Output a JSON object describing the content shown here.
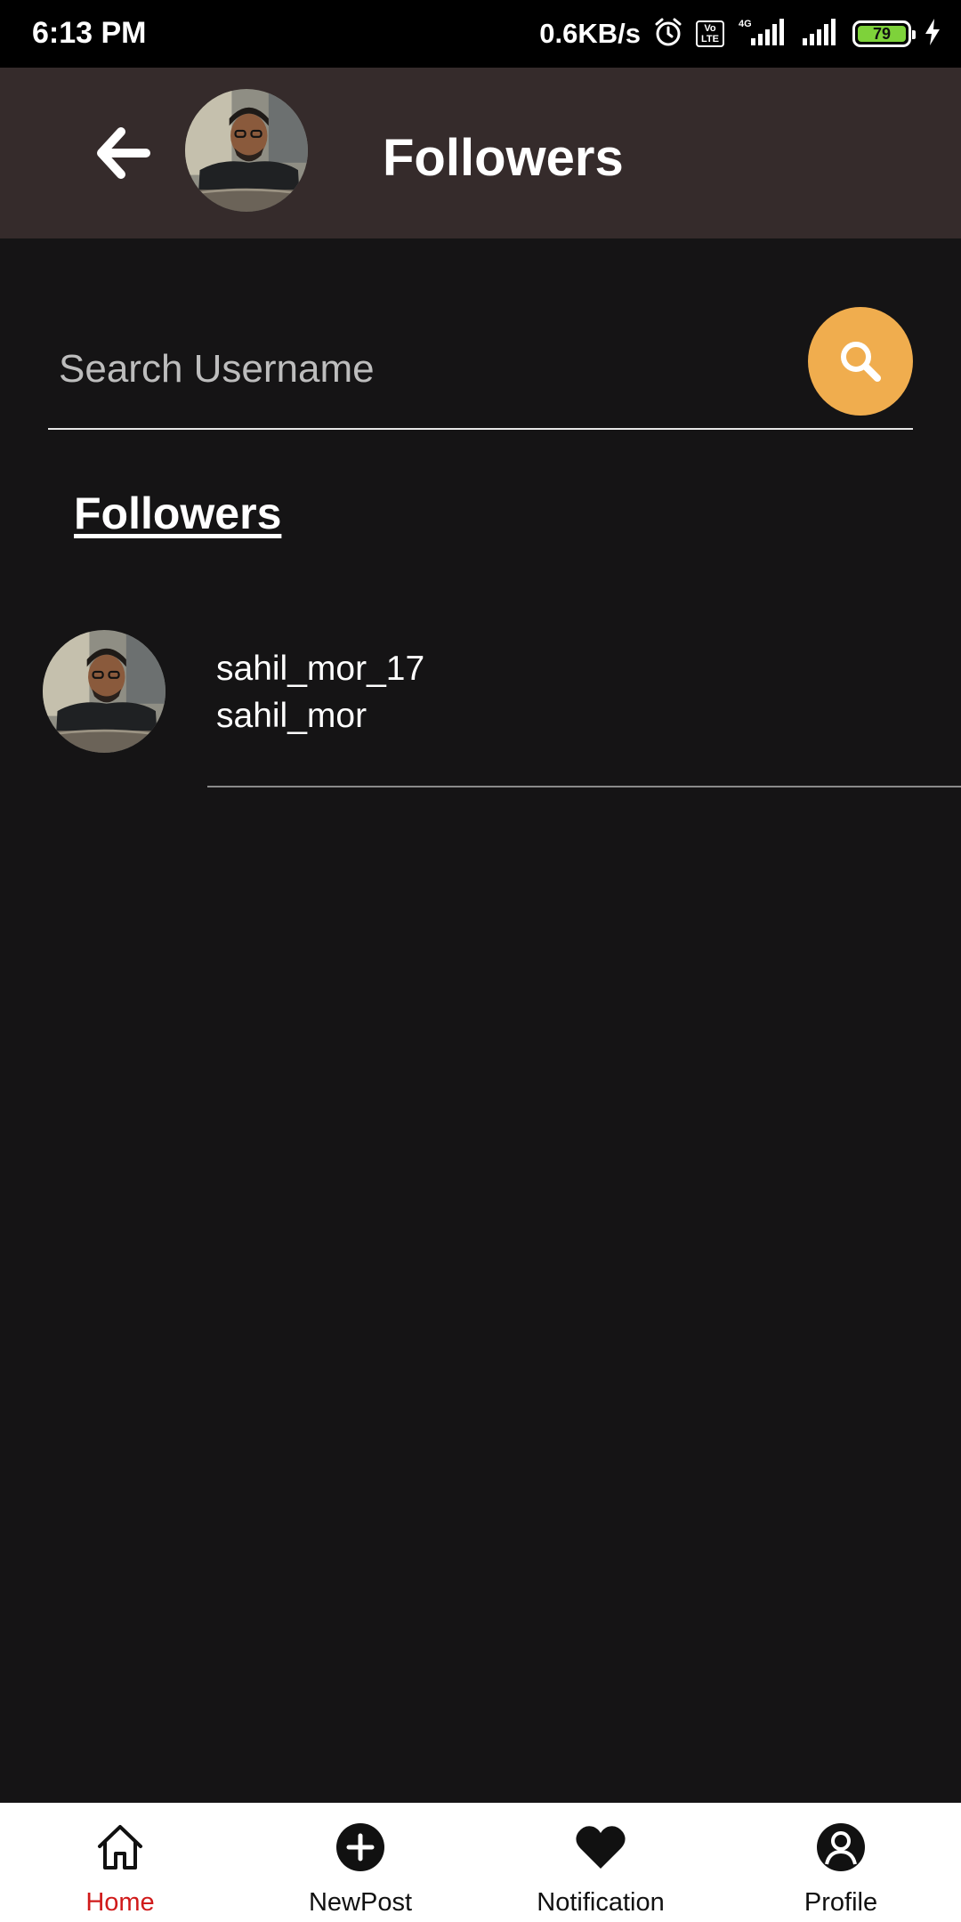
{
  "status_bar": {
    "time": "6:13 PM",
    "net_speed": "0.6KB/s",
    "volte_label": "Vo LTE",
    "network_type": "4G",
    "battery_percent": "79"
  },
  "app_bar": {
    "title": "Followers"
  },
  "search": {
    "placeholder": "Search Username",
    "value": ""
  },
  "section": {
    "heading": "Followers"
  },
  "followers": [
    {
      "username": "sahil_mor_17",
      "name": "sahil_mor"
    }
  ],
  "bottom_nav": {
    "items": [
      {
        "label": "Home",
        "icon": "home-icon",
        "active": true
      },
      {
        "label": "NewPost",
        "icon": "add-circle-icon",
        "active": false
      },
      {
        "label": "Notification",
        "icon": "heart-icon",
        "active": false
      },
      {
        "label": "Profile",
        "icon": "profile-icon",
        "active": false
      }
    ]
  },
  "colors": {
    "background": "#151415",
    "app_bar": "#352b2b",
    "search_button": "#f0ad4e",
    "active_nav": "#d01a1a",
    "battery": "#7ed23a"
  }
}
